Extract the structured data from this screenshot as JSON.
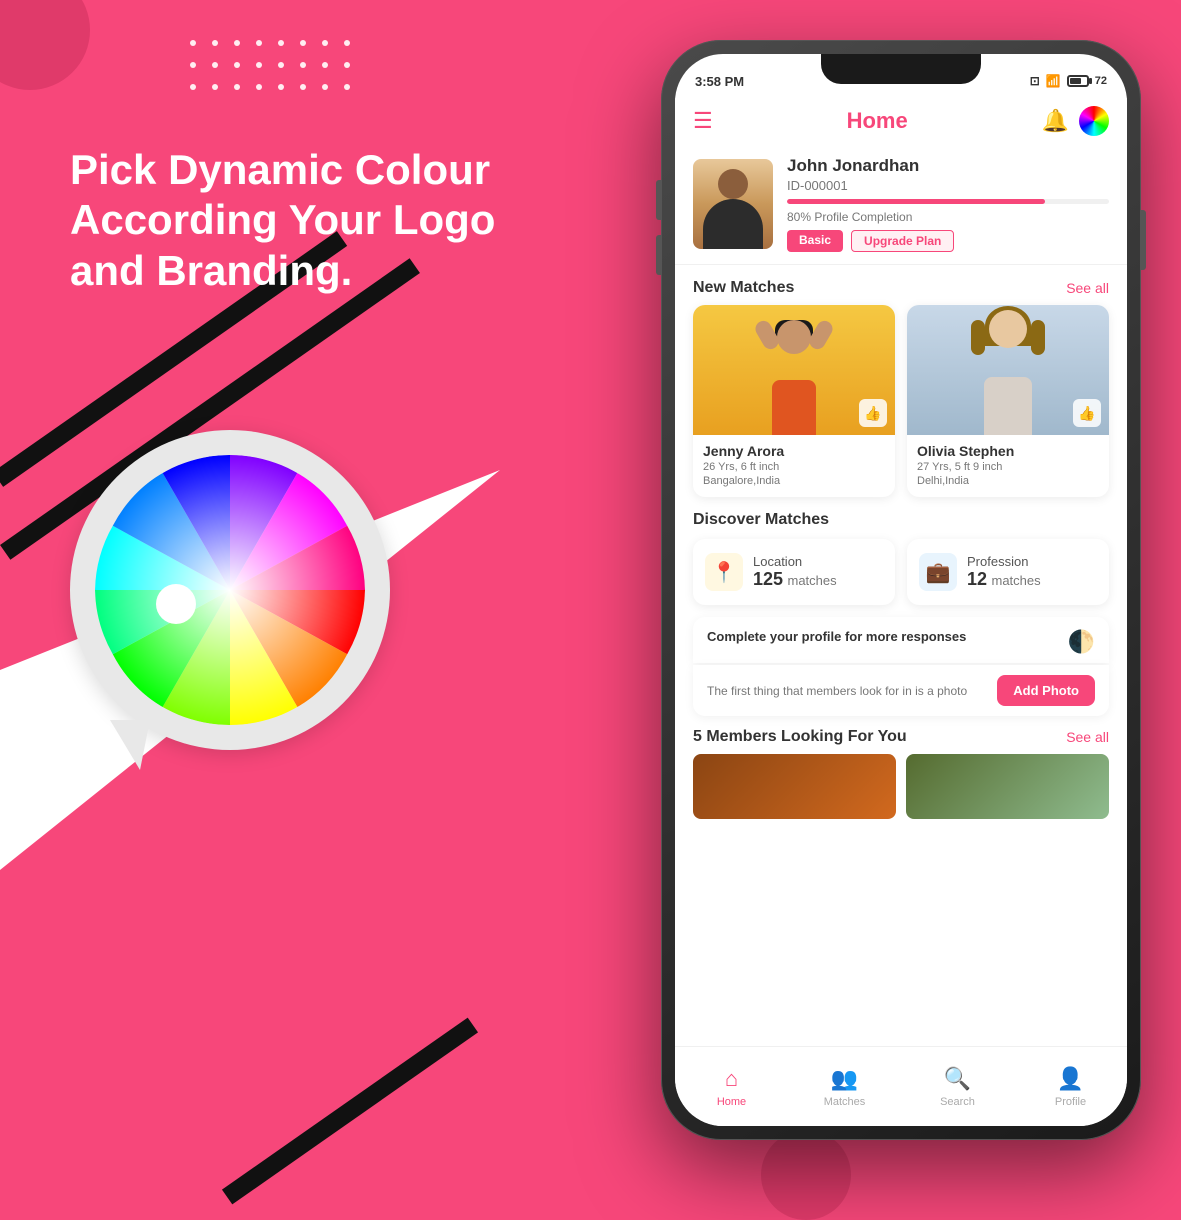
{
  "page": {
    "background_color": "#F7477A"
  },
  "left": {
    "headline": "Pick Dynamic Colour According Your Logo and Branding."
  },
  "phone": {
    "status_bar": {
      "time": "3:58 PM",
      "battery": "72"
    },
    "header": {
      "title": "Home"
    },
    "profile": {
      "name": "John Jonardhan",
      "id": "ID-000001",
      "completion": "80% Profile Completion",
      "badge_basic": "Basic",
      "badge_upgrade": "Upgrade Plan"
    },
    "new_matches": {
      "section_title": "New Matches",
      "see_all": "See all",
      "matches": [
        {
          "name": "Jenny Arora",
          "detail1": "26 Yrs, 6 ft inch",
          "detail2": "Bangalore,India"
        },
        {
          "name": "Olivia Stephen",
          "detail1": "27 Yrs, 5 ft 9 inch",
          "detail2": "Delhi,India"
        }
      ]
    },
    "discover_matches": {
      "section_title": "Discover Matches",
      "location": {
        "label": "Location",
        "count": "125",
        "unit": "matches"
      },
      "profession": {
        "label": "Profession",
        "count": "12",
        "unit": "matches"
      }
    },
    "complete_profile": {
      "title": "Complete your profile for more responses",
      "description": "The first thing that members look for in is a photo",
      "add_photo_label": "Add Photo"
    },
    "members_section": {
      "title": "5 Members Looking For You",
      "see_all": "See all"
    },
    "bottom_nav": {
      "items": [
        {
          "label": "Home",
          "icon": "home",
          "active": true
        },
        {
          "label": "Matches",
          "icon": "matches",
          "active": false
        },
        {
          "label": "Search",
          "icon": "search",
          "active": false
        },
        {
          "label": "Profile",
          "icon": "profile",
          "active": false
        }
      ]
    }
  }
}
